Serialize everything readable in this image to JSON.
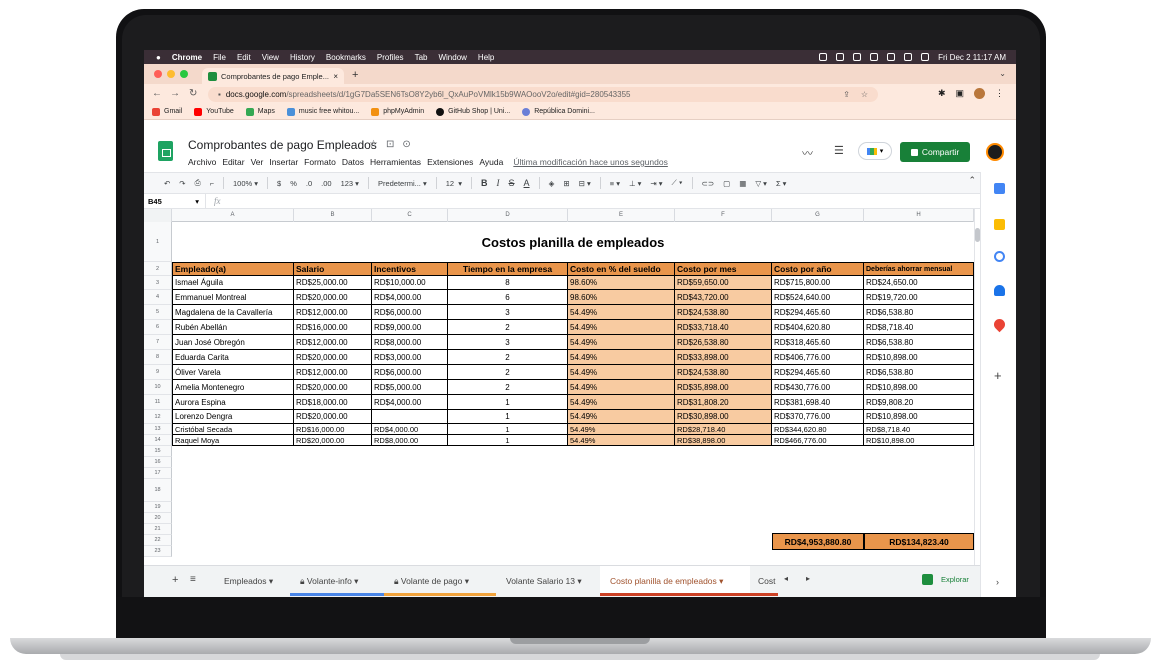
{
  "menubar": {
    "items": [
      "Chrome",
      "File",
      "Edit",
      "View",
      "History",
      "Bookmarks",
      "Profiles",
      "Tab",
      "Window",
      "Help"
    ],
    "clock": "Fri Dec 2  11:17 AM"
  },
  "browser": {
    "tab_title": "Comprobantes de pago Emple...",
    "tab_close": "×",
    "new_tab": "+",
    "url_host": "docs.google.com",
    "url_path": "/spreadsheets/d/1gG7Da5SEN6TsO8Y2yb6l_QxAuPoVMlk15b9WAOooV2o/edit#gid=280543355",
    "bookmarks": [
      {
        "label": "Gmail",
        "color": "#ea4335"
      },
      {
        "label": "YouTube",
        "color": "#ff0000"
      },
      {
        "label": "Maps",
        "color": "#34a853"
      },
      {
        "label": "music free whitou...",
        "color": "#4a90d9"
      },
      {
        "label": "phpMyAdmin",
        "color": "#f29111"
      },
      {
        "label": "GitHub Shop | Uni...",
        "color": "#111111"
      },
      {
        "label": "República Domini...",
        "color": "#6b7fd7"
      }
    ]
  },
  "doc": {
    "title": "Comprobantes de pago Empleados",
    "menu": [
      "Archivo",
      "Editar",
      "Ver",
      "Insertar",
      "Formato",
      "Datos",
      "Herramientas",
      "Extensiones",
      "Ayuda"
    ],
    "last_modified": "Última modificación hace unos segundos",
    "share_label": "Compartir"
  },
  "toolbar": {
    "zoom": "100%",
    "currency": "$",
    "percent": "%",
    "dec_less": ".0",
    "dec_more": ".00",
    "format_more": "123",
    "font": "Predetermi...",
    "font_size": "12",
    "bold": "B",
    "italic": "I",
    "strike": "S",
    "underline": "A"
  },
  "formula_bar": {
    "cell_ref": "B45",
    "fx": "fx"
  },
  "grid": {
    "columns": [
      "A",
      "B",
      "C",
      "D",
      "E",
      "F",
      "G",
      "H"
    ],
    "title": "Costos planilla de empleados",
    "headers": [
      "Empleado(a)",
      "Salario",
      "Incentivos",
      "Tiempo en la empresa",
      "Costo en % del sueldo",
      "Costo por mes",
      "Costo por año",
      "Deberías ahorrar mensual"
    ],
    "rows": [
      [
        "Ismael Águila",
        "RD$25,000.00",
        "RD$10,000.00",
        "8",
        "98.60%",
        "RD$59,650.00",
        "RD$715,800.00",
        "RD$24,650.00"
      ],
      [
        "Emmanuel Montreal",
        "RD$20,000.00",
        "RD$4,000.00",
        "6",
        "98.60%",
        "RD$43,720.00",
        "RD$524,640.00",
        "RD$19,720.00"
      ],
      [
        "Magdalena de la Cavallería",
        "RD$12,000.00",
        "RD$6,000.00",
        "3",
        "54.49%",
        "RD$24,538.80",
        "RD$294,465.60",
        "RD$6,538.80"
      ],
      [
        "Rubén Abellán",
        "RD$16,000.00",
        "RD$9,000.00",
        "2",
        "54.49%",
        "RD$33,718.40",
        "RD$404,620.80",
        "RD$8,718.40"
      ],
      [
        "Juan José Obregón",
        "RD$12,000.00",
        "RD$8,000.00",
        "3",
        "54.49%",
        "RD$26,538.80",
        "RD$318,465.60",
        "RD$6,538.80"
      ],
      [
        "Eduarda Carita",
        "RD$20,000.00",
        "RD$3,000.00",
        "2",
        "54.49%",
        "RD$33,898.00",
        "RD$406,776.00",
        "RD$10,898.00"
      ],
      [
        "Óliver Varela",
        "RD$12,000.00",
        "RD$6,000.00",
        "2",
        "54.49%",
        "RD$24,538.80",
        "RD$294,465.60",
        "RD$6,538.80"
      ],
      [
        "Amelia Montenegro",
        "RD$20,000.00",
        "RD$5,000.00",
        "2",
        "54.49%",
        "RD$35,898.00",
        "RD$430,776.00",
        "RD$10,898.00"
      ],
      [
        "Aurora Espina",
        "RD$18,000.00",
        "RD$4,000.00",
        "1",
        "54.49%",
        "RD$31,808.20",
        "RD$381,698.40",
        "RD$9,808.20"
      ],
      [
        "Lorenzo Dengra",
        "RD$20,000.00",
        "",
        "1",
        "54.49%",
        "RD$30,898.00",
        "RD$370,776.00",
        "RD$10,898.00"
      ],
      [
        "Cristóbal Secada",
        "RD$16,000.00",
        "RD$4,000.00",
        "1",
        "54.49%",
        "RD$28,718.40",
        "RD$344,620.80",
        "RD$8,718.40"
      ],
      [
        "Raquel Moya",
        "RD$20,000.00",
        "RD$8,000.00",
        "1",
        "54.49%",
        "RD$38,898.00",
        "RD$466,776.00",
        "RD$10,898.00"
      ]
    ],
    "row_numbers": [
      "1",
      "2",
      "3",
      "4",
      "5",
      "6",
      "7",
      "8",
      "9",
      "10",
      "11",
      "12",
      "13",
      "14",
      "15",
      "16",
      "17",
      "18",
      "19",
      "20",
      "21",
      "22",
      "23"
    ],
    "total_year": "RD$4,953,880.80",
    "total_savings": "RD$134,823.40"
  },
  "sheets": [
    {
      "label": "Empleados",
      "locked": false,
      "color": ""
    },
    {
      "label": "Volante-info",
      "locked": true,
      "color": "#4a86e8"
    },
    {
      "label": "Volante de pago",
      "locked": true,
      "color": "#f1a33c"
    },
    {
      "label": "Volante Salario 13",
      "locked": false,
      "color": ""
    },
    {
      "label": "Costo planilla de empleados",
      "locked": false,
      "color": "#cc4125"
    },
    {
      "label": "Cost",
      "locked": false,
      "color": "#cc4125"
    }
  ],
  "explore_label": "Explorar"
}
